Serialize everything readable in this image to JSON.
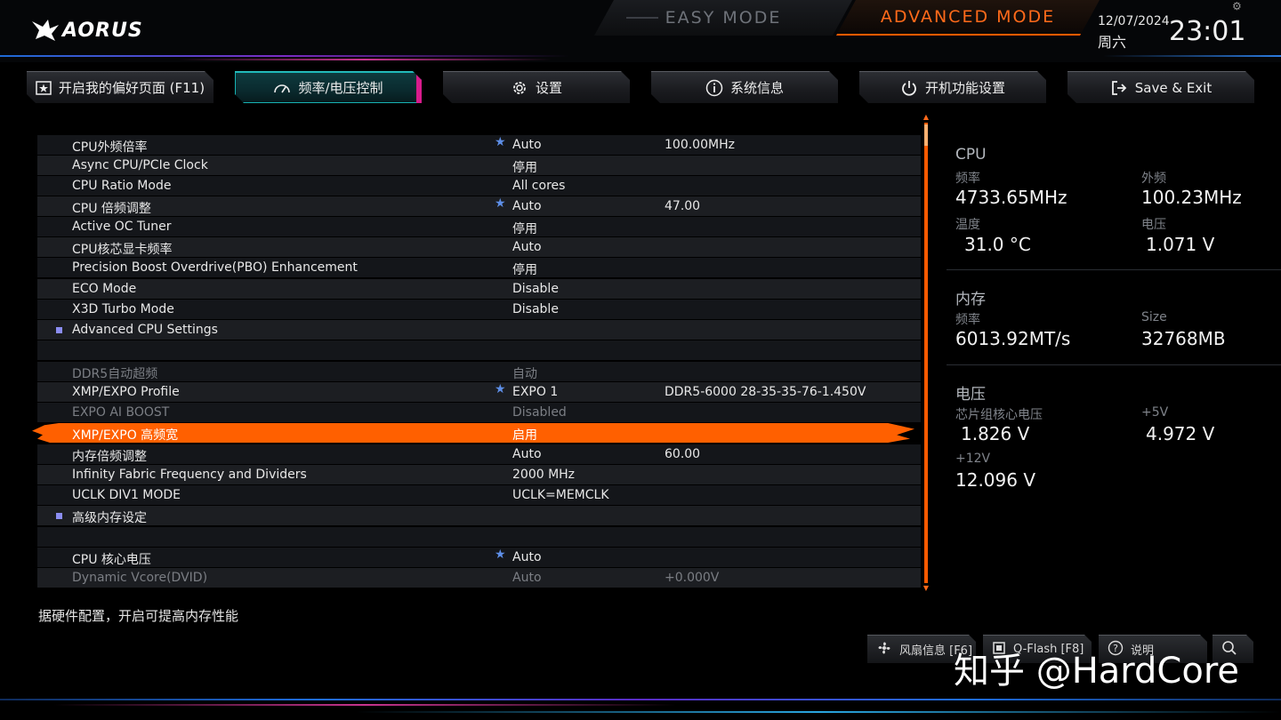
{
  "header": {
    "logo_text": "AORUS",
    "easy_mode": "EASY MODE",
    "advanced_mode": "ADVANCED MODE",
    "date": "12/07/2024",
    "weekday": "周六",
    "time": "23:01"
  },
  "tabs": [
    {
      "label": "开启我的偏好页面 (F11)",
      "icon": "star-page-icon"
    },
    {
      "label": "频率/电压控制",
      "icon": "gauge-icon"
    },
    {
      "label": "设置",
      "icon": "gear-icon"
    },
    {
      "label": "系统信息",
      "icon": "info-icon"
    },
    {
      "label": "开机功能设置",
      "icon": "power-icon"
    },
    {
      "label": "Save & Exit",
      "icon": "exit-icon"
    }
  ],
  "settings": [
    {
      "label": "CPU外频倍率",
      "value": "Auto",
      "value2": "100.00MHz",
      "star": "★"
    },
    {
      "label": "Async CPU/PCIe Clock",
      "value": "停用",
      "value2": "",
      "star": ""
    },
    {
      "label": "CPU Ratio Mode",
      "value": "All cores",
      "value2": "",
      "star": ""
    },
    {
      "label": "CPU 倍频调整",
      "value": "Auto",
      "value2": "47.00",
      "star": "★"
    },
    {
      "label": "Active OC Tuner",
      "value": "停用",
      "value2": "",
      "star": ""
    },
    {
      "label": "CPU核芯显卡频率",
      "value": "Auto",
      "value2": "",
      "star": ""
    },
    {
      "label": "Precision Boost Overdrive(PBO) Enhancement",
      "value": "停用",
      "value2": "",
      "star": ""
    },
    {
      "label": "ECO Mode",
      "value": "Disable",
      "value2": "",
      "star": ""
    },
    {
      "label": "X3D Turbo Mode",
      "value": "Disable",
      "value2": "",
      "star": ""
    },
    {
      "label": "Advanced CPU Settings",
      "value": "",
      "value2": "",
      "star": ""
    },
    {
      "label": "",
      "value": "",
      "value2": "",
      "star": ""
    },
    {
      "label": "DDR5自动超频",
      "value": "自动",
      "value2": "",
      "star": ""
    },
    {
      "label": "XMP/EXPO Profile",
      "value": "EXPO 1",
      "value2": "DDR5-6000 28-35-35-76-1.450V",
      "star": "★"
    },
    {
      "label": "EXPO AI BOOST",
      "value": "Disabled",
      "value2": "",
      "star": ""
    },
    {
      "label": "XMP/EXPO 高频宽",
      "value": "启用",
      "value2": "",
      "star": ""
    },
    {
      "label": "内存倍频调整",
      "value": "Auto",
      "value2": "60.00",
      "star": ""
    },
    {
      "label": "Infinity Fabric Frequency and Dividers",
      "value": "2000 MHz",
      "value2": "",
      "star": ""
    },
    {
      "label": "UCLK DIV1 MODE",
      "value": "UCLK=MEMCLK",
      "value2": "",
      "star": ""
    },
    {
      "label": "高级内存设定",
      "value": "",
      "value2": "",
      "star": ""
    },
    {
      "label": "",
      "value": "",
      "value2": "",
      "star": ""
    },
    {
      "label": "CPU 核心电压",
      "value": "Auto",
      "value2": "",
      "star": "★"
    },
    {
      "label": "Dynamic Vcore(DVID)",
      "value": "Auto",
      "value2": "+0.000V",
      "star": ""
    }
  ],
  "help_text": "据硬件配置，开启可提高内存性能",
  "status": {
    "cpu": {
      "title": "CPU",
      "freq_label": "频率",
      "freq": "4733.65MHz",
      "bclk_label": "外频",
      "bclk": "100.23MHz",
      "temp_label": "温度",
      "temp": "31.0 °C",
      "volt_label": "电压",
      "volt": "1.071 V"
    },
    "memory": {
      "title": "内存",
      "freq_label": "频率",
      "freq": "6013.92MT/s",
      "size_label": "Size",
      "size": "32768MB"
    },
    "voltage": {
      "title": "电压",
      "chipset_label": "芯片组核心电压",
      "chipset": "1.826 V",
      "p5v_label": "+5V",
      "p5v": "4.972 V",
      "p12v_label": "+12V",
      "p12v": "12.096 V"
    }
  },
  "bottom_buttons": [
    {
      "label": "风扇信息 [F6]",
      "icon": "fan-icon"
    },
    {
      "label": "Q-Flash [F8]",
      "icon": "qflash-icon"
    },
    {
      "label": "说明",
      "icon": "help-icon"
    },
    {
      "label": "",
      "icon": "search-icon"
    }
  ],
  "watermark": "知乎 @HardCore",
  "colors": {
    "accent_orange": "#ff6000",
    "active_tab_teal": "#17b3b3",
    "active_tab_magenta": "#d81b8c",
    "star_blue": "#5e8fe8"
  }
}
